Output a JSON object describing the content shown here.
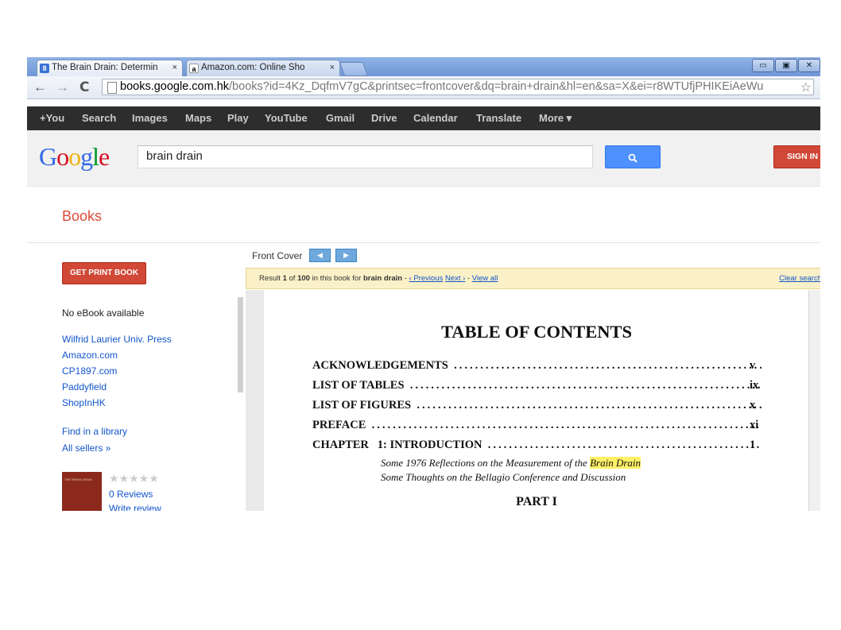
{
  "browser": {
    "tabs": [
      {
        "title": "The Brain Drain: Determin",
        "favicon": "8"
      },
      {
        "title": "Amazon.com: Online Sho",
        "favicon": "a"
      }
    ],
    "tab_close": "×",
    "address": {
      "host": "books.google.com.hk",
      "path": "/books?id=4Kz_DqfmV7gC&printsec=frontcover&dq=brain+drain&hl=en&sa=X&ei=r8WTUfjPHIKEiAeWu"
    },
    "window_controls": [
      "▭",
      "▣",
      "✕"
    ],
    "nav": {
      "back": "←",
      "forward": "→",
      "reload": "C",
      "star": "☆"
    }
  },
  "gbar": {
    "items": [
      "+You",
      "Search",
      "Images",
      "Maps",
      "Play",
      "YouTube",
      "Gmail",
      "Drive",
      "Calendar",
      "Translate",
      "More ▾"
    ]
  },
  "header": {
    "logo_letters": [
      "G",
      "o",
      "o",
      "g",
      "l",
      "e"
    ],
    "logo_colors": [
      "#3369e8",
      "#d50f25",
      "#eeb211",
      "#3369e8",
      "#009925",
      "#d50f25"
    ],
    "search_value": "brain drain",
    "search_icon": "🔍",
    "signin_label": "SIGN IN"
  },
  "books": {
    "title": "Books"
  },
  "left": {
    "get_print_label": "GET PRINT BOOK",
    "no_ebook": "No eBook available",
    "sellers": [
      "Wilfrid Laurier Univ. Press",
      "Amazon.com",
      "CP1897.com",
      "Paddyfield",
      "ShopInHK"
    ],
    "find_library": "Find in a library",
    "all_sellers": "All sellers »",
    "thumb_text": "THE BRAIN DRAIN",
    "stars": "★★★★★",
    "reviews": "0 Reviews",
    "write_review": "Write review"
  },
  "viewer": {
    "front_cover": "Front Cover",
    "prev_icon": "◀",
    "next_icon": "▶",
    "result": {
      "prefix": "Result ",
      "num": "1",
      "of": " of ",
      "total": "100",
      "in_book": " in this book for ",
      "query": "brain drain",
      "sep1": " - ",
      "prev": "‹ Previous",
      "next": "Next ›",
      "sep2": " - ",
      "view_all": "View all",
      "clear": "Clear search",
      "clear_x": "✕"
    },
    "page": {
      "title": "TABLE OF CONTENTS",
      "entries": [
        {
          "label": "ACKNOWLEDGEMENTS",
          "page": "v"
        },
        {
          "label": "LIST OF TABLES",
          "page": "ix"
        },
        {
          "label": "LIST OF FIGURES",
          "page": "x"
        },
        {
          "label": "PREFACE",
          "page": "xi"
        },
        {
          "label": "CHAPTER   1: INTRODUCTION",
          "page": "1"
        }
      ],
      "dots": "......................................................................................",
      "sub1_pre": "Some 1976 Reflections on the Measurement of the ",
      "sub1_hl": "Brain Drain",
      "sub2": "Some Thoughts on the Bellagio Conference and Discussion",
      "part": "PART I"
    }
  }
}
